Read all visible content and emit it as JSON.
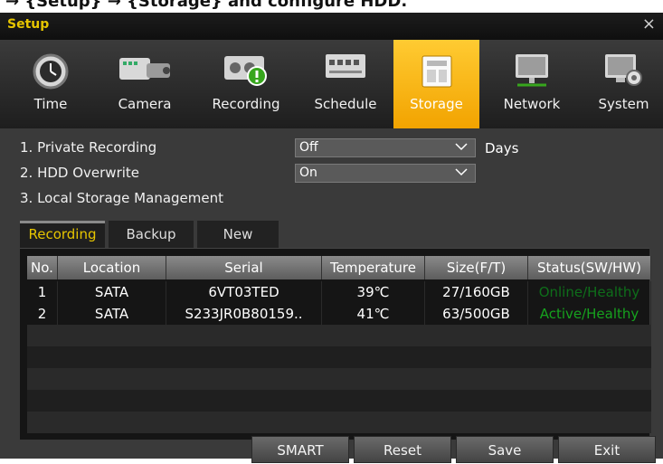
{
  "caption": {
    "text": "→ {Setup} → {Storage} and configure HDD."
  },
  "window": {
    "title": "Setup",
    "close_glyph": "×"
  },
  "nav": {
    "tabs": [
      {
        "label": "Time",
        "icon": "clock-icon"
      },
      {
        "label": "Camera",
        "icon": "camera-icon"
      },
      {
        "label": "Recording",
        "icon": "recording-icon"
      },
      {
        "label": "Schedule",
        "icon": "schedule-icon"
      },
      {
        "label": "Storage",
        "icon": "storage-icon",
        "active": true
      },
      {
        "label": "Network",
        "icon": "network-icon"
      },
      {
        "label": "System",
        "icon": "system-icon"
      }
    ]
  },
  "settings": {
    "private_recording": {
      "label": "1. Private Recording",
      "value": "Off",
      "suffix": "Days"
    },
    "hdd_overwrite": {
      "label": "2. HDD Overwrite",
      "value": "On"
    },
    "local_storage": {
      "label": "3. Local Storage Management"
    }
  },
  "subtabs": [
    {
      "label": "Recording",
      "active": true
    },
    {
      "label": "Backup"
    },
    {
      "label": "New"
    }
  ],
  "table": {
    "headers": [
      "No.",
      "Location",
      "Serial",
      "Temperature",
      "Size(F/T)",
      "Status(SW/HW)"
    ],
    "rows": [
      [
        "1",
        "SATA",
        "6VT03TED",
        "39℃",
        "27/160GB",
        "Online/Healthy"
      ],
      [
        "2",
        "SATA",
        "S233JR0B80159..",
        "41℃",
        "63/500GB",
        "Active/Healthy"
      ]
    ]
  },
  "buttons": {
    "smart": "SMART",
    "reset": "Reset",
    "save": "Save",
    "exit": "Exit"
  },
  "colors": {
    "accent": "#f6b300",
    "title": "#e6c500",
    "status_online": "#0e6e1a",
    "status_active": "#16a21e"
  }
}
